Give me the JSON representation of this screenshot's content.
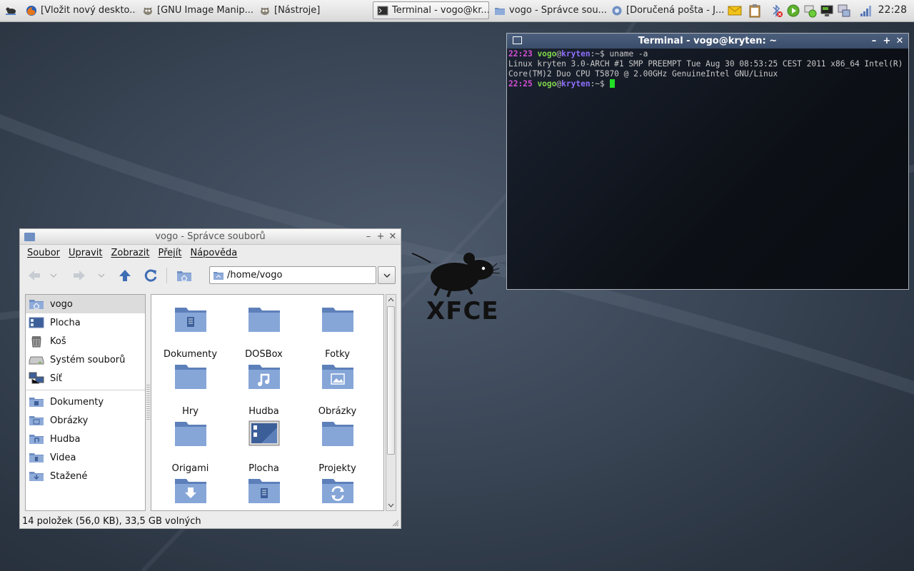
{
  "panel": {
    "tasks": [
      {
        "label": "[Vložit nový deskto...",
        "icon": "firefox-icon"
      },
      {
        "label": "[GNU Image Manip...",
        "icon": "gimp-icon"
      },
      {
        "label": "[Nástroje]",
        "icon": "gimp-icon"
      },
      {
        "label": "Terminal - vogo@kr...",
        "icon": "terminal-icon"
      },
      {
        "label": "vogo - Správce sou...",
        "icon": "folder-icon"
      },
      {
        "label": "[Doručená pošta - J...",
        "icon": "mail-icon"
      }
    ],
    "clock": "22:28"
  },
  "terminal": {
    "title": "Terminal - vogo@kryten: ~",
    "lines": [
      {
        "time": "22:23",
        "user": "vogo",
        "at": "@",
        "host": "kryten",
        "path": ":~$",
        "cmd": " uname -a"
      },
      {
        "output": "Linux kryten 3.0-ARCH #1 SMP PREEMPT Tue Aug 30 08:53:25 CEST 2011 x86_64 Intel(R) Core(TM)2 Duo CPU T5870 @ 2.00GHz GenuineIntel GNU/Linux"
      },
      {
        "time": "22:25",
        "user": "vogo",
        "at": "@",
        "host": "kryten",
        "path": ":~$",
        "cmd": " "
      }
    ]
  },
  "desktop": {
    "logo_text": "XFCE"
  },
  "filemanager": {
    "title": "vogo - Správce souborů",
    "menu": [
      "Soubor",
      "Upravit",
      "Zobrazit",
      "Přejít",
      "Nápověda"
    ],
    "location": "/home/vogo",
    "places": [
      {
        "label": "vogo",
        "icon": "home-icon"
      },
      {
        "label": "Plocha",
        "icon": "desktop-icon"
      },
      {
        "label": "Koš",
        "icon": "trash-icon"
      },
      {
        "label": "Systém souborů",
        "icon": "drive-icon"
      },
      {
        "label": "Síť",
        "icon": "network-icon"
      }
    ],
    "bookmarks": [
      {
        "label": "Dokumenty",
        "icon": "documents-folder-icon"
      },
      {
        "label": "Obrázky",
        "icon": "pictures-folder-icon"
      },
      {
        "label": "Hudba",
        "icon": "music-folder-icon"
      },
      {
        "label": "Videa",
        "icon": "video-folder-icon"
      },
      {
        "label": "Stažené",
        "icon": "download-folder-icon"
      }
    ],
    "files": [
      {
        "label": "Dokumenty",
        "emblem": "doc"
      },
      {
        "label": "DOSBox",
        "emblem": ""
      },
      {
        "label": "Fotky",
        "emblem": ""
      },
      {
        "label": "Hry",
        "emblem": ""
      },
      {
        "label": "Hudba",
        "emblem": "music"
      },
      {
        "label": "Obrázky",
        "emblem": "picture"
      },
      {
        "label": "Origami",
        "emblem": ""
      },
      {
        "label": "Plocha",
        "emblem": "desktop"
      },
      {
        "label": "Projekty",
        "emblem": ""
      },
      {
        "label": "",
        "emblem": "download"
      },
      {
        "label": "",
        "emblem": "doc"
      },
      {
        "label": "",
        "emblem": "sync"
      }
    ],
    "status": "14 položek (56,0 KB), 33,5 GB volných"
  },
  "colors": {
    "selection": "#dcdcdc",
    "folder": "#7b9bd0",
    "term_bg": "#10151c"
  }
}
